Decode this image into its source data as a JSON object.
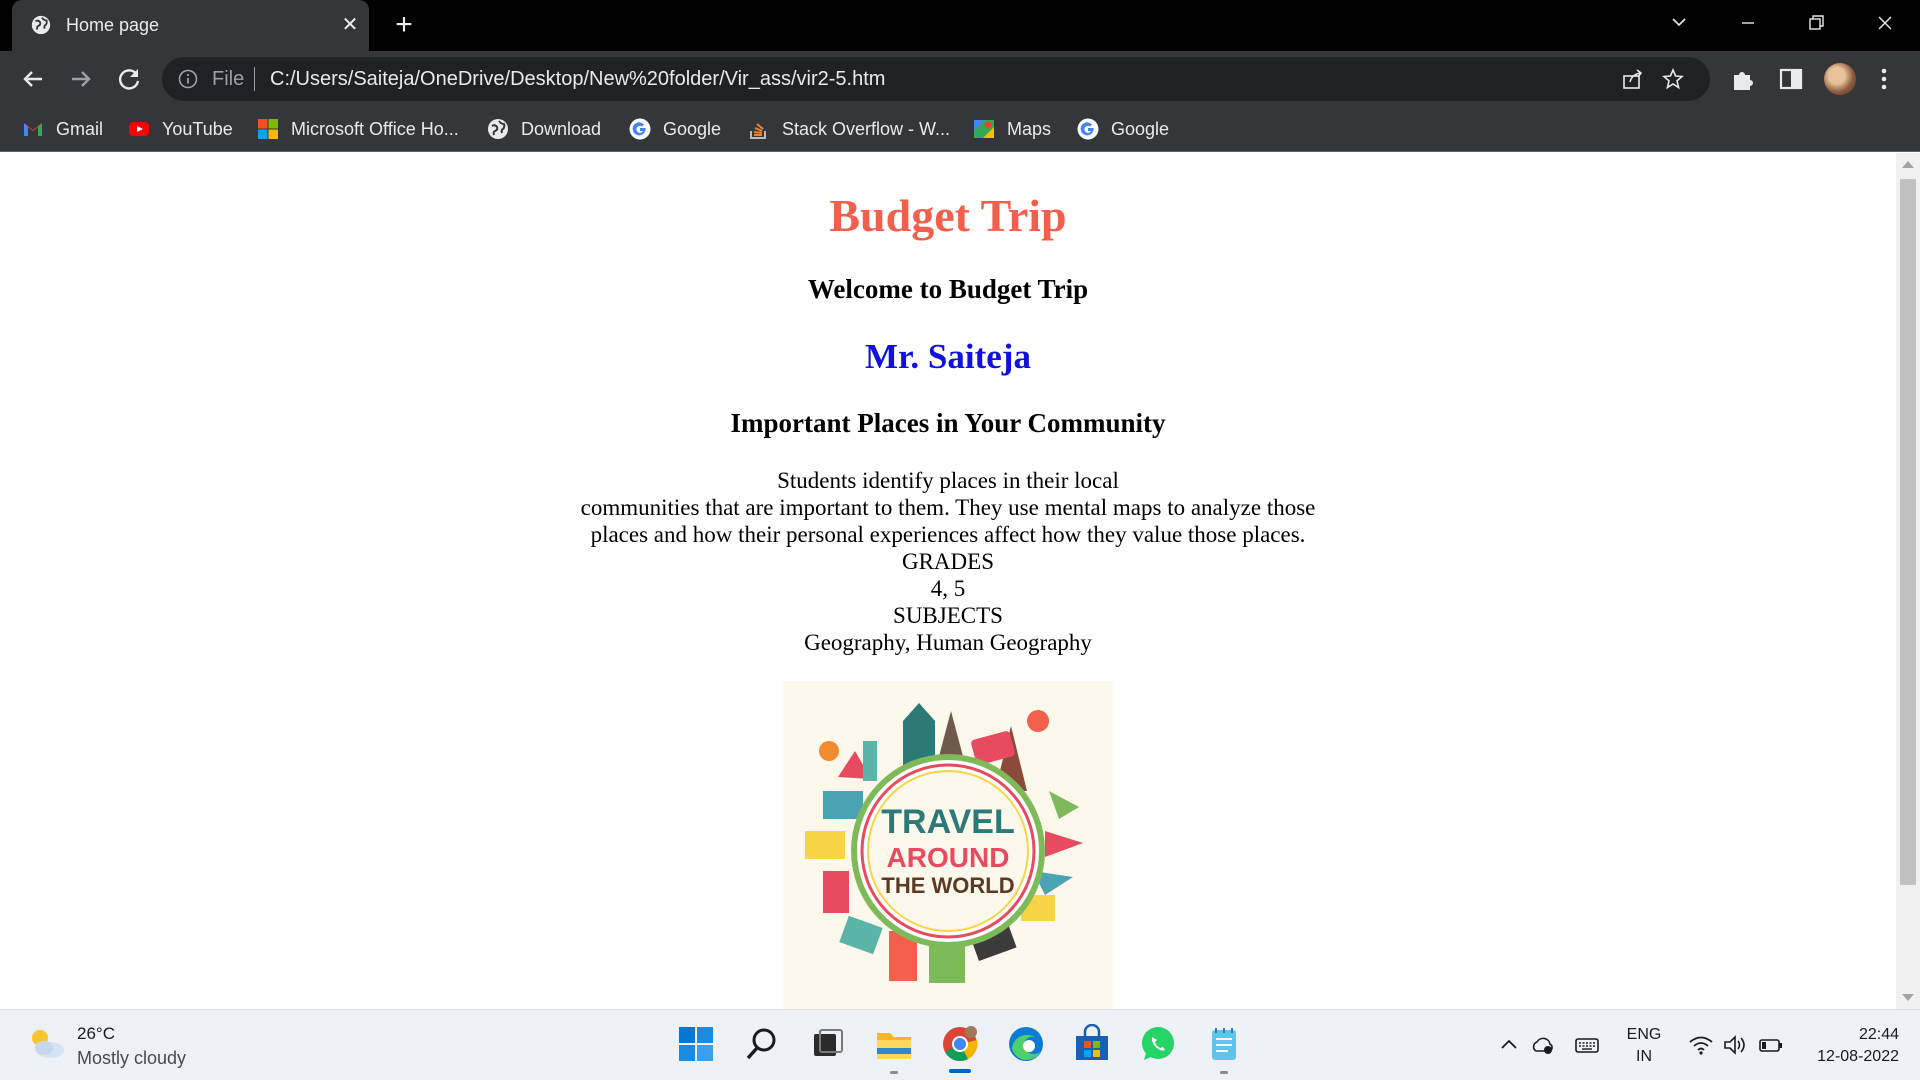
{
  "browser": {
    "tab": {
      "title": "Home page"
    },
    "address": {
      "scheme": "File",
      "url": "C:/Users/Saiteja/OneDrive/Desktop/New%20folder/Vir_ass/vir2-5.htm"
    },
    "bookmarks": [
      {
        "label": "Gmail",
        "icon": "gmail-icon"
      },
      {
        "label": "YouTube",
        "icon": "youtube-icon"
      },
      {
        "label": "Microsoft Office Ho...",
        "icon": "microsoft-icon"
      },
      {
        "label": "Download",
        "icon": "globe-icon"
      },
      {
        "label": "Google",
        "icon": "google-icon"
      },
      {
        "label": "Stack Overflow - W...",
        "icon": "stackoverflow-icon"
      },
      {
        "label": "Maps",
        "icon": "maps-icon"
      },
      {
        "label": "Google",
        "icon": "google-icon"
      }
    ]
  },
  "page": {
    "title": "Budget Trip",
    "welcome": "Welcome to Budget Trip",
    "author": "Mr. Saiteja",
    "section_heading": "Important Places in Your Community",
    "description": [
      "Students identify places in their local",
      "communities that are important to them. They use mental maps to analyze those",
      "places and how their personal experiences affect how they value those places.",
      "GRADES",
      "4, 5",
      "SUBJECTS",
      "Geography, Human Geography"
    ],
    "image": {
      "line1": "TRAVEL",
      "line2": "AROUND",
      "line3": "THE WORLD"
    }
  },
  "taskbar": {
    "weather": {
      "temp": "26°C",
      "condition": "Mostly cloudy"
    },
    "language": {
      "line1": "ENG",
      "line2": "IN"
    },
    "clock": {
      "time": "22:44",
      "date": "12-08-2022"
    }
  },
  "colors": {
    "title": "#f25f4c",
    "author": "#1010e0",
    "chrome_dark": "#35363a",
    "omnibox": "#202124"
  }
}
